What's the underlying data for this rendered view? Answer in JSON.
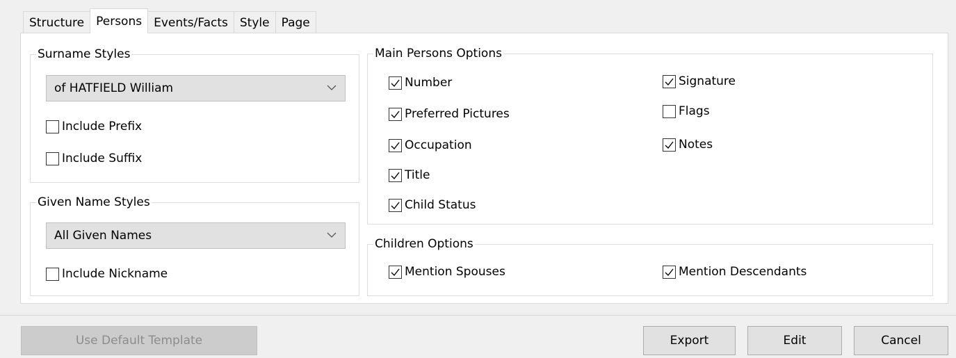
{
  "tabs": [
    "Structure",
    "Persons",
    "Events/Facts",
    "Style",
    "Page"
  ],
  "surname_styles": {
    "title": "Surname Styles",
    "selected": "of HATFIELD William",
    "include_prefix": {
      "label": "Include Prefix",
      "checked": false
    },
    "include_suffix": {
      "label": "Include Suffix",
      "checked": false
    }
  },
  "given_name_styles": {
    "title": "Given Name Styles",
    "selected": "All Given Names",
    "include_nickname": {
      "label": "Include Nickname",
      "checked": false
    }
  },
  "main_persons_options": {
    "title": "Main Persons Options",
    "number": {
      "label": "Number",
      "checked": true
    },
    "preferred_pictures": {
      "label": "Preferred Pictures",
      "checked": true
    },
    "occupation": {
      "label": "Occupation",
      "checked": true
    },
    "title_opt": {
      "label": "Title",
      "checked": true
    },
    "child_status": {
      "label": "Child Status",
      "checked": true
    },
    "signature": {
      "label": "Signature",
      "checked": true
    },
    "flags": {
      "label": "Flags",
      "checked": false
    },
    "notes": {
      "label": "Notes",
      "checked": true
    }
  },
  "children_options": {
    "title": "Children Options",
    "mention_spouses": {
      "label": "Mention Spouses",
      "checked": true
    },
    "mention_descendants": {
      "label": "Mention Descendants",
      "checked": true
    }
  },
  "buttons": {
    "use_default_template": "Use Default Template",
    "export": "Export",
    "edit": "Edit",
    "cancel": "Cancel"
  }
}
